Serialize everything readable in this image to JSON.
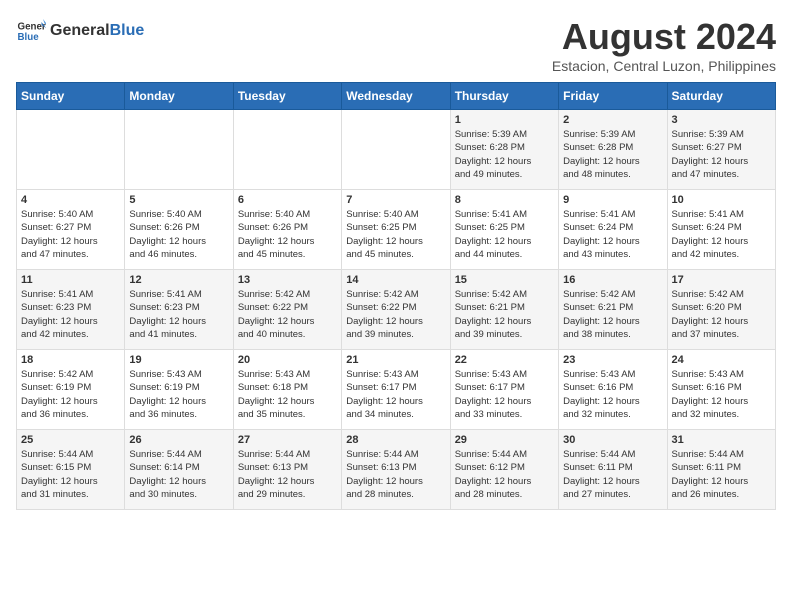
{
  "header": {
    "logo_general": "General",
    "logo_blue": "Blue",
    "month_year": "August 2024",
    "location": "Estacion, Central Luzon, Philippines"
  },
  "days_of_week": [
    "Sunday",
    "Monday",
    "Tuesday",
    "Wednesday",
    "Thursday",
    "Friday",
    "Saturday"
  ],
  "weeks": [
    [
      {
        "day": "",
        "info": ""
      },
      {
        "day": "",
        "info": ""
      },
      {
        "day": "",
        "info": ""
      },
      {
        "day": "",
        "info": ""
      },
      {
        "day": "1",
        "info": "Sunrise: 5:39 AM\nSunset: 6:28 PM\nDaylight: 12 hours\nand 49 minutes."
      },
      {
        "day": "2",
        "info": "Sunrise: 5:39 AM\nSunset: 6:28 PM\nDaylight: 12 hours\nand 48 minutes."
      },
      {
        "day": "3",
        "info": "Sunrise: 5:39 AM\nSunset: 6:27 PM\nDaylight: 12 hours\nand 47 minutes."
      }
    ],
    [
      {
        "day": "4",
        "info": "Sunrise: 5:40 AM\nSunset: 6:27 PM\nDaylight: 12 hours\nand 47 minutes."
      },
      {
        "day": "5",
        "info": "Sunrise: 5:40 AM\nSunset: 6:26 PM\nDaylight: 12 hours\nand 46 minutes."
      },
      {
        "day": "6",
        "info": "Sunrise: 5:40 AM\nSunset: 6:26 PM\nDaylight: 12 hours\nand 45 minutes."
      },
      {
        "day": "7",
        "info": "Sunrise: 5:40 AM\nSunset: 6:25 PM\nDaylight: 12 hours\nand 45 minutes."
      },
      {
        "day": "8",
        "info": "Sunrise: 5:41 AM\nSunset: 6:25 PM\nDaylight: 12 hours\nand 44 minutes."
      },
      {
        "day": "9",
        "info": "Sunrise: 5:41 AM\nSunset: 6:24 PM\nDaylight: 12 hours\nand 43 minutes."
      },
      {
        "day": "10",
        "info": "Sunrise: 5:41 AM\nSunset: 6:24 PM\nDaylight: 12 hours\nand 42 minutes."
      }
    ],
    [
      {
        "day": "11",
        "info": "Sunrise: 5:41 AM\nSunset: 6:23 PM\nDaylight: 12 hours\nand 42 minutes."
      },
      {
        "day": "12",
        "info": "Sunrise: 5:41 AM\nSunset: 6:23 PM\nDaylight: 12 hours\nand 41 minutes."
      },
      {
        "day": "13",
        "info": "Sunrise: 5:42 AM\nSunset: 6:22 PM\nDaylight: 12 hours\nand 40 minutes."
      },
      {
        "day": "14",
        "info": "Sunrise: 5:42 AM\nSunset: 6:22 PM\nDaylight: 12 hours\nand 39 minutes."
      },
      {
        "day": "15",
        "info": "Sunrise: 5:42 AM\nSunset: 6:21 PM\nDaylight: 12 hours\nand 39 minutes."
      },
      {
        "day": "16",
        "info": "Sunrise: 5:42 AM\nSunset: 6:21 PM\nDaylight: 12 hours\nand 38 minutes."
      },
      {
        "day": "17",
        "info": "Sunrise: 5:42 AM\nSunset: 6:20 PM\nDaylight: 12 hours\nand 37 minutes."
      }
    ],
    [
      {
        "day": "18",
        "info": "Sunrise: 5:42 AM\nSunset: 6:19 PM\nDaylight: 12 hours\nand 36 minutes."
      },
      {
        "day": "19",
        "info": "Sunrise: 5:43 AM\nSunset: 6:19 PM\nDaylight: 12 hours\nand 36 minutes."
      },
      {
        "day": "20",
        "info": "Sunrise: 5:43 AM\nSunset: 6:18 PM\nDaylight: 12 hours\nand 35 minutes."
      },
      {
        "day": "21",
        "info": "Sunrise: 5:43 AM\nSunset: 6:17 PM\nDaylight: 12 hours\nand 34 minutes."
      },
      {
        "day": "22",
        "info": "Sunrise: 5:43 AM\nSunset: 6:17 PM\nDaylight: 12 hours\nand 33 minutes."
      },
      {
        "day": "23",
        "info": "Sunrise: 5:43 AM\nSunset: 6:16 PM\nDaylight: 12 hours\nand 32 minutes."
      },
      {
        "day": "24",
        "info": "Sunrise: 5:43 AM\nSunset: 6:16 PM\nDaylight: 12 hours\nand 32 minutes."
      }
    ],
    [
      {
        "day": "25",
        "info": "Sunrise: 5:44 AM\nSunset: 6:15 PM\nDaylight: 12 hours\nand 31 minutes."
      },
      {
        "day": "26",
        "info": "Sunrise: 5:44 AM\nSunset: 6:14 PM\nDaylight: 12 hours\nand 30 minutes."
      },
      {
        "day": "27",
        "info": "Sunrise: 5:44 AM\nSunset: 6:13 PM\nDaylight: 12 hours\nand 29 minutes."
      },
      {
        "day": "28",
        "info": "Sunrise: 5:44 AM\nSunset: 6:13 PM\nDaylight: 12 hours\nand 28 minutes."
      },
      {
        "day": "29",
        "info": "Sunrise: 5:44 AM\nSunset: 6:12 PM\nDaylight: 12 hours\nand 28 minutes."
      },
      {
        "day": "30",
        "info": "Sunrise: 5:44 AM\nSunset: 6:11 PM\nDaylight: 12 hours\nand 27 minutes."
      },
      {
        "day": "31",
        "info": "Sunrise: 5:44 AM\nSunset: 6:11 PM\nDaylight: 12 hours\nand 26 minutes."
      }
    ]
  ]
}
